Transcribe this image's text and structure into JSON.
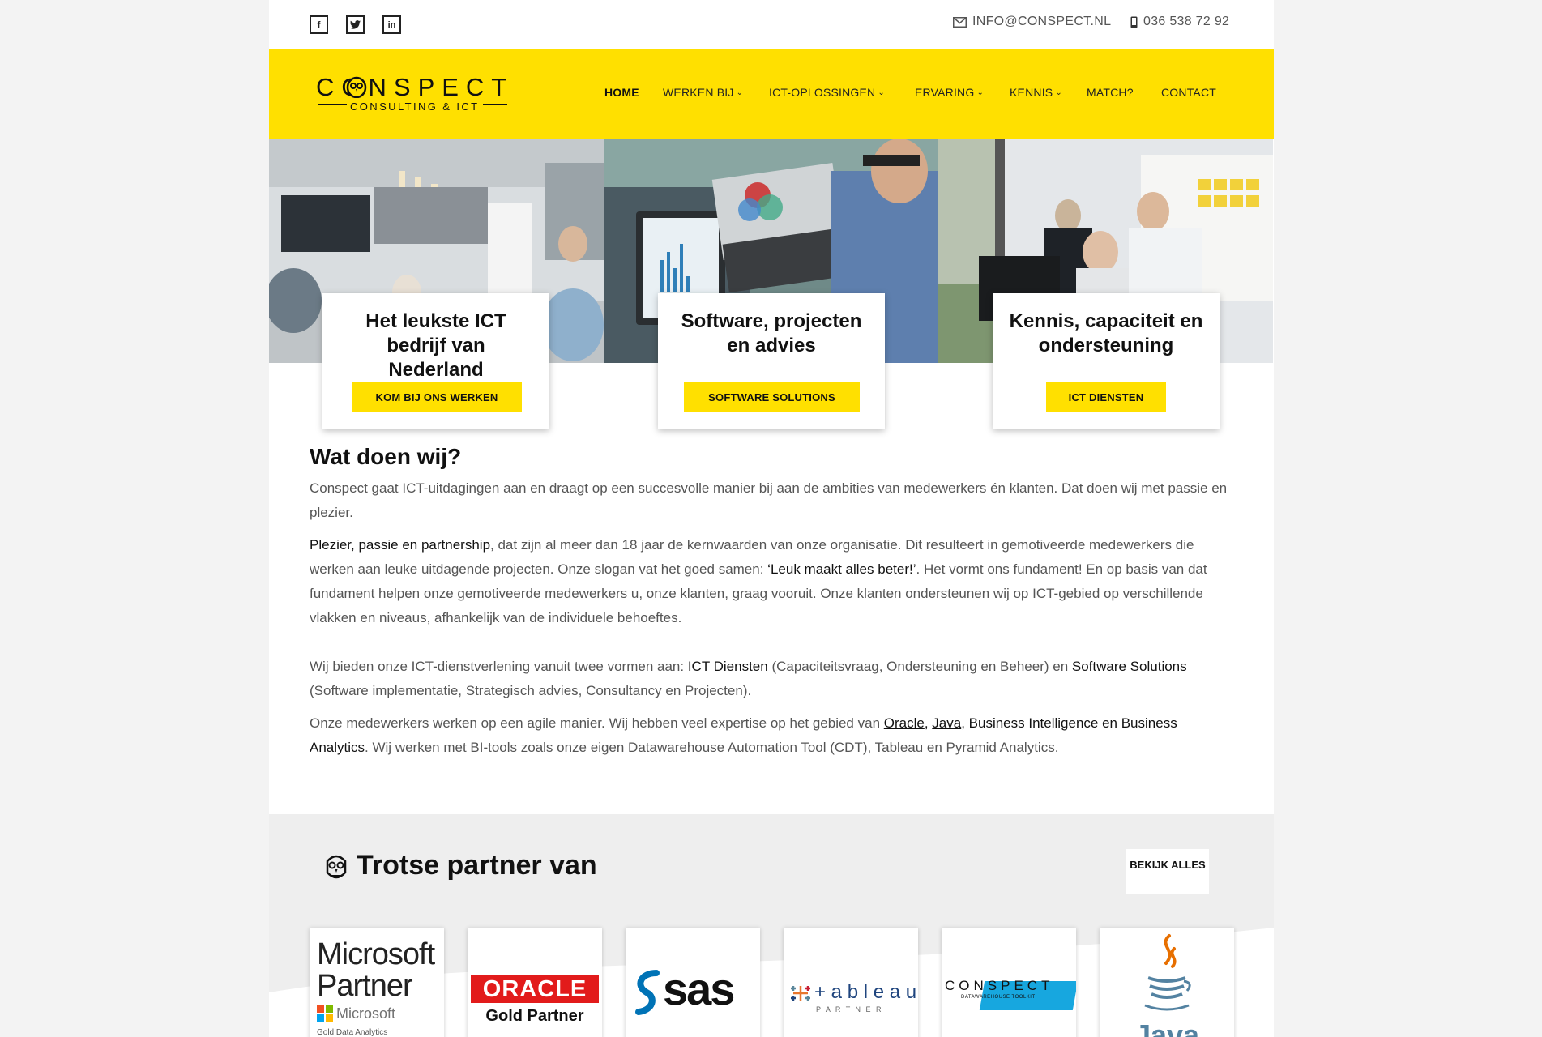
{
  "topbar": {
    "social": [
      "f",
      "t",
      "in"
    ],
    "email": "INFO@CONSPECT.NL",
    "phone": "036 538 72 92"
  },
  "header": {
    "logo_main": "CONSPECT",
    "logo_sub": "CONSULTING & ICT",
    "nav": [
      "HOME",
      "WERKEN BIJ",
      "ICT-OPLOSSINGEN",
      "ERVARING",
      "KENNIS",
      "MATCH?",
      "CONTACT"
    ],
    "active_nav": "HOME"
  },
  "cards": [
    {
      "title": "Het leukste ICT bedrijf van Nederland",
      "button": "KOM BIJ ONS WERKEN"
    },
    {
      "title": "Software, projecten en advies",
      "button": "SOFTWARE SOLUTIONS"
    },
    {
      "title": "Kennis, capaciteit en ondersteuning",
      "button": "ICT DIENSTEN"
    }
  ],
  "content": {
    "heading": "Wat doen wij?",
    "p1": "Conspect gaat ICT-uitdagingen aan en draagt op een succesvolle manier bij aan de ambities van medewerkers én klanten. Dat doen wij met passie en plezier.",
    "p2_strong": "Plezier, passie en partnership",
    "p2_rest1": ", dat zijn al meer dan 18 jaar de kernwaarden van onze organisatie. Dit resulteert in gemotiveerde medewerkers die werken aan leuke uitdagende projecten. Onze slogan vat het goed samen: ",
    "p2_slogan": "‘Leuk maakt alles beter!’",
    "p2_rest2": ". Het vormt ons fundament! En op basis van dat fundament helpen onze gemotiveerde medewerkers u, onze klanten, graag vooruit. Onze klanten ondersteunen wij op ICT-gebied op verschillende vlakken en niveaus, afhankelijk van de individuele behoeftes.",
    "p3_a": "Wij bieden onze ICT-dienstverlening vanuit twee vormen aan: ",
    "p3_ict": "ICT Diensten",
    "p3_b": " (Capaciteitsvraag, Ondersteuning en Beheer) en ",
    "p3_sw": "Software Solutions",
    "p3_c": " (Software implementatie, Strategisch advies, Consultancy en Projecten).",
    "p4_a": "Onze medewerkers werken op een agile manier. Wij hebben veel expertise op het gebied van ",
    "p4_oracle": "Oracle",
    "p4_comma": ", ",
    "p4_java": "Java",
    "p4_bi": ", Business Intelligence en Business Analytics",
    "p4_b": ". Wij werken met BI-tools zoals onze eigen Datawarehouse Automation Tool (CDT), Tableau en Pyramid Analytics."
  },
  "partners": {
    "title": "Trotse partner van",
    "button": "BEKIJK ALLES",
    "logos": {
      "microsoft_line1": "Microsoft",
      "microsoft_line2": "Partner",
      "microsoft_small": "Microsoft",
      "microsoft_tag": "Gold Data Analytics",
      "oracle": "ORACLE",
      "oracle_tag": "Gold Partner",
      "sas": "sas",
      "tableau": "+ a b l e a u",
      "tableau_tag": "P A R T N E R",
      "conspect": "CONSPECT",
      "conspect_tag": "DATAWAREHOUSE TOOLKIT",
      "java": "Java"
    }
  },
  "colors": {
    "brand_yellow": "#ffe000",
    "text_dark": "#111111",
    "text_body": "#555555"
  }
}
